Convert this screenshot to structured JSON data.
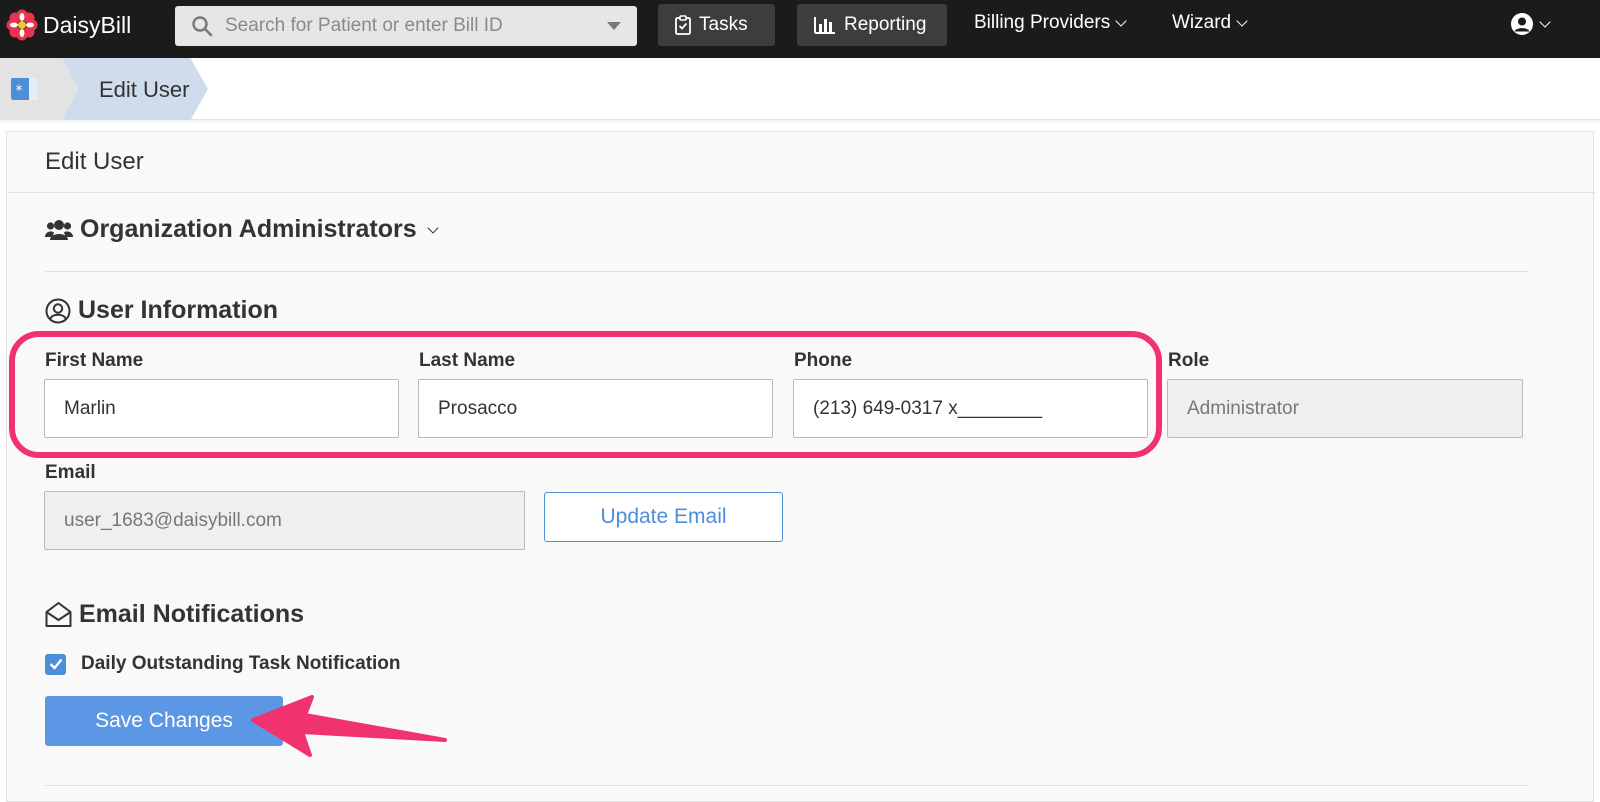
{
  "app": {
    "brand": "DaisyBill"
  },
  "nav": {
    "search_placeholder": "Search for Patient or enter Bill ID",
    "tasks_label": "Tasks",
    "reporting_label": "Reporting",
    "billing_providers_label": "Billing Providers",
    "wizard_label": "Wizard"
  },
  "breadcrumb": {
    "current": "Edit User"
  },
  "page": {
    "title": "Edit User",
    "org_section": "Organization Administrators",
    "user_info_section": "User Information",
    "email_notifications_section": "Email Notifications"
  },
  "form": {
    "first_name_label": "First Name",
    "first_name_value": "Marlin",
    "last_name_label": "Last Name",
    "last_name_value": "Prosacco",
    "phone_label": "Phone",
    "phone_value": "(213) 649-0317 x________",
    "role_label": "Role",
    "role_value": "Administrator",
    "email_label": "Email",
    "email_value": "user_1683@daisybill.com",
    "update_email_label": "Update Email",
    "daily_notification_label": "Daily Outstanding Task Notification",
    "daily_notification_checked": true,
    "save_label": "Save Changes"
  },
  "colors": {
    "accent": "#5b97e5",
    "annotation": "#f0326e",
    "topbar": "#1b1b1b"
  },
  "icons": {
    "logo": "daisy-flower-icon",
    "search": "search-icon",
    "tasks": "clipboard-check-icon",
    "reporting": "bar-chart-icon",
    "user_menu": "user-circle-icon",
    "org": "users-group-icon",
    "user_info": "user-circle-icon",
    "email": "envelope-open-icon"
  }
}
